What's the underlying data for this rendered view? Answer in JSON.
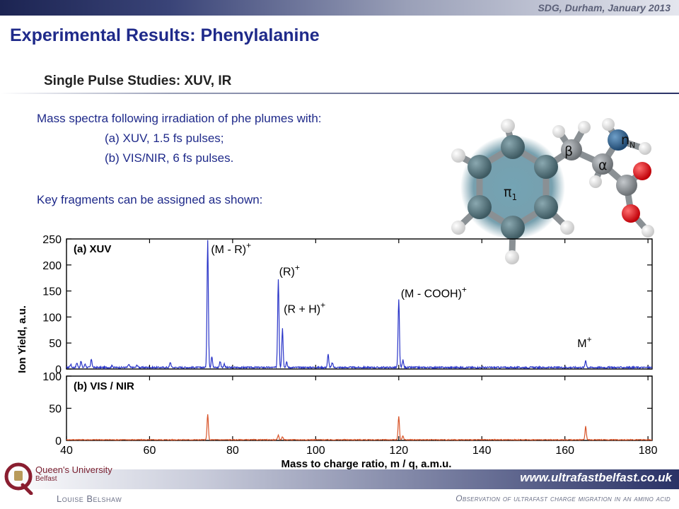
{
  "header": {
    "event": "SDG, Durham, January 2013",
    "title": "Experimental Results: Phenylalanine",
    "subtitle": "Single Pulse Studies: XUV, IR"
  },
  "body": {
    "line1": "Mass spectra following irradiation of phe plumes with:",
    "line2": "(a) XUV, 1.5 fs pulses;",
    "line3": "(b) VIS/NIR, 6 fs pulses.",
    "line4": "Key fragments can be assigned as shown:"
  },
  "molecule": {
    "labels": {
      "pi": "π",
      "pi_sub": "1",
      "beta": "β",
      "alpha": "α",
      "n": "n",
      "n_sub": "N"
    },
    "colors": {
      "ring": "#4d6f78",
      "glow": "#5f8fa0",
      "nitrogen": "#2f5f86",
      "oxygen": "#e0141a",
      "hydrogen": "#f2f2f2",
      "carbon": "#8b8f92"
    }
  },
  "footer": {
    "url": "www.ultrafastbelfast.co.uk",
    "author": "Louise Belshaw",
    "talk_title": "Observation of ultrafast charge migration in an amino acid",
    "logo_line1": "Queen's University",
    "logo_line2": "Belfast"
  },
  "chart_data": {
    "type": "line",
    "xlabel": "Mass to charge ratio, m / q, a.m.u.",
    "ylabel": "Ion Yield, a.u.",
    "xlim": [
      40,
      181
    ],
    "xticks": [
      40,
      60,
      80,
      100,
      120,
      140,
      160,
      180
    ],
    "panels": [
      {
        "name": "(a) XUV",
        "color": "#2a35c8",
        "ylim": [
          0,
          250
        ],
        "yticks": [
          0,
          50,
          100,
          150,
          200,
          250
        ],
        "baseline": 3,
        "peaks": [
          {
            "x": 41,
            "y": 6
          },
          {
            "x": 42.5,
            "y": 9
          },
          {
            "x": 43.5,
            "y": 12
          },
          {
            "x": 44.5,
            "y": 7
          },
          {
            "x": 46,
            "y": 16
          },
          {
            "x": 51,
            "y": 4
          },
          {
            "x": 55,
            "y": 6
          },
          {
            "x": 57,
            "y": 5
          },
          {
            "x": 65,
            "y": 10
          },
          {
            "x": 74,
            "y": 245
          },
          {
            "x": 75,
            "y": 22
          },
          {
            "x": 77,
            "y": 12
          },
          {
            "x": 78,
            "y": 7
          },
          {
            "x": 91,
            "y": 170
          },
          {
            "x": 92,
            "y": 75
          },
          {
            "x": 93,
            "y": 10
          },
          {
            "x": 103,
            "y": 25
          },
          {
            "x": 104,
            "y": 9
          },
          {
            "x": 120,
            "y": 130
          },
          {
            "x": 121,
            "y": 14
          },
          {
            "x": 165,
            "y": 14
          }
        ],
        "annotations": [
          {
            "text": "(M - R)",
            "sup": "+"
          },
          {
            "text": "(R)",
            "sup": "+"
          },
          {
            "text": "(R + H)",
            "sup": "+"
          },
          {
            "text": "(M - COOH)",
            "sup": "+"
          },
          {
            "text": "M",
            "sup": "+"
          }
        ]
      },
      {
        "name": "(b) VIS / NIR",
        "color": "#d8552a",
        "ylim": [
          0,
          100
        ],
        "yticks": [
          0,
          50,
          100
        ],
        "baseline": 1,
        "peaks": [
          {
            "x": 74,
            "y": 40
          },
          {
            "x": 91,
            "y": 7
          },
          {
            "x": 92,
            "y": 5
          },
          {
            "x": 120,
            "y": 36
          },
          {
            "x": 121,
            "y": 6
          },
          {
            "x": 165,
            "y": 21
          }
        ],
        "annotations": []
      }
    ]
  }
}
